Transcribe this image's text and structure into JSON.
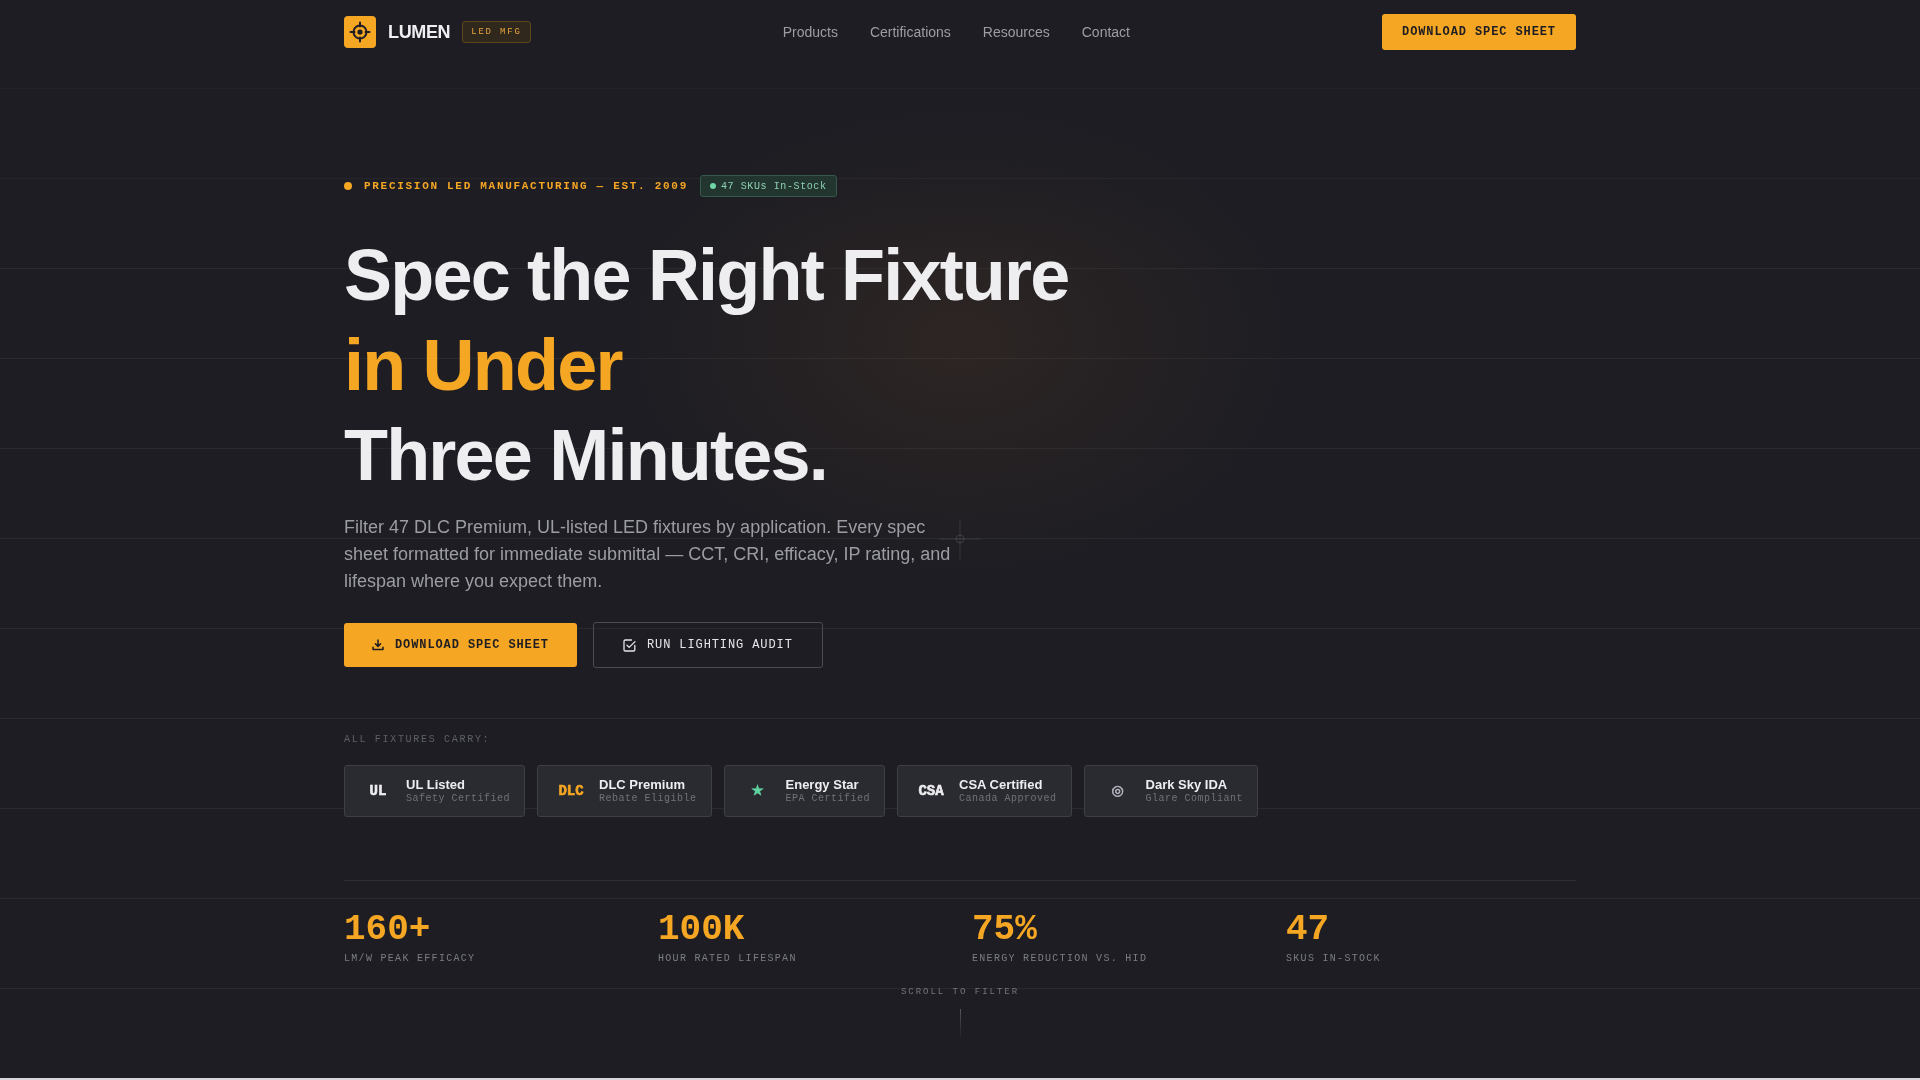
{
  "nav": {
    "brand": "LUMEN",
    "badge": "LED MFG",
    "links": [
      "Products",
      "Certifications",
      "Resources",
      "Contact"
    ],
    "cta": "DOWNLOAD SPEC SHEET"
  },
  "hero": {
    "eyebrow": "PRECISION LED MANUFACTURING — EST. 2009",
    "stock_badge": "47 SKUs In-Stock",
    "headline": [
      {
        "text": "Spec the Right Fixture",
        "highlighted": false
      },
      {
        "text": "in Under",
        "highlighted": true
      },
      {
        "text": "Three Minutes.",
        "highlighted": false
      }
    ],
    "description": "Filter 47 DLC Premium, UL-listed LED fixtures by application. Every spec sheet formatted for immediate submittal — CCT, CRI, efficacy, IP rating, and lifespan where you expect them.",
    "buttons": [
      {
        "label": "DOWNLOAD SPEC SHEET",
        "kind": "primary"
      },
      {
        "label": "RUN LIGHTING AUDIT",
        "kind": "secondary"
      }
    ]
  },
  "certifications": {
    "label": "ALL FIXTURES CARRY:",
    "items": [
      {
        "mark": "UL",
        "color": "#ececef",
        "title": "UL Listed",
        "subtitle": "Safety Certified"
      },
      {
        "mark": "DLC",
        "color": "#f5a623",
        "title": "DLC Premium",
        "subtitle": "Rebate Eligible"
      },
      {
        "mark": "★",
        "color": "#5fd3a0",
        "title": "Energy Star",
        "subtitle": "EPA Certified"
      },
      {
        "mark": "CSA",
        "color": "#ececef",
        "title": "CSA Certified",
        "subtitle": "Canada Approved"
      },
      {
        "mark": "◎",
        "color": "#b4b6c0",
        "title": "Dark Sky IDA",
        "subtitle": "Glare Compliant"
      }
    ]
  },
  "stats": [
    {
      "value": "160+",
      "label": "LM/W PEAK EFFICACY"
    },
    {
      "value": "100K",
      "label": "HOUR RATED LIFESPAN"
    },
    {
      "value": "75%",
      "label": "ENERGY REDUCTION VS. HID"
    },
    {
      "value": "47",
      "label": "SKUS IN-STOCK"
    }
  ],
  "scroll_hint": "SCROLL TO FILTER"
}
